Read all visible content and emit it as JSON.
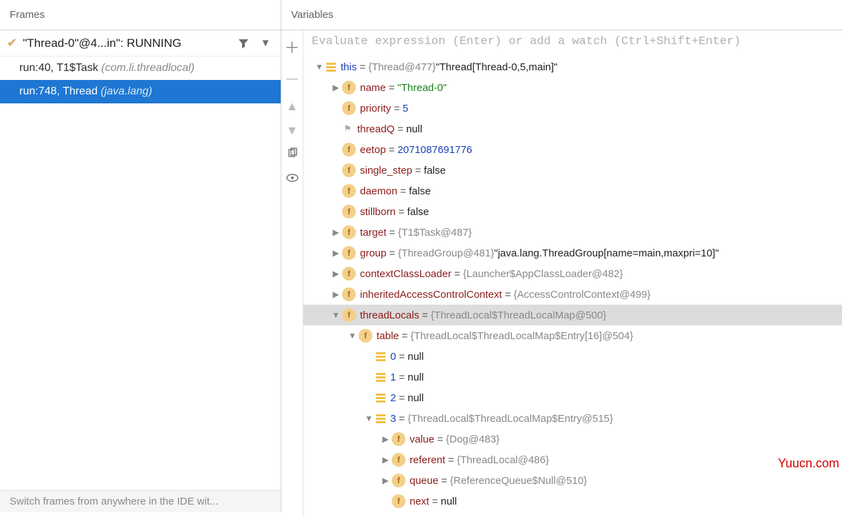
{
  "frames": {
    "header": "Frames",
    "thread": "\"Thread-0\"@4...in\": RUNNING",
    "rows": [
      {
        "loc": "run:40, T1$Task ",
        "pkg": "(com.li.threadlocal)"
      },
      {
        "loc": "run:748, Thread ",
        "pkg": "(java.lang)"
      }
    ],
    "tip": "Switch frames from anywhere in the IDE wit..."
  },
  "variables": {
    "header": "Variables",
    "eval_placeholder": "Evaluate expression (Enter) or add a watch (Ctrl+Shift+Enter)"
  },
  "tree": [
    {
      "d": 0,
      "ar": "down",
      "icon": "bars",
      "name": "this",
      "nclass": "blue",
      "val": "{Thread@477}",
      "vclass": "ref",
      "extra": " \"Thread[Thread-0,5,main]\""
    },
    {
      "d": 1,
      "ar": "right",
      "icon": "f",
      "name": "name",
      "nclass": "fname",
      "val": "\"Thread-0\"",
      "vclass": "strv"
    },
    {
      "d": 1,
      "ar": "none",
      "icon": "f",
      "name": "priority",
      "nclass": "fname",
      "val": "5",
      "vclass": "blue"
    },
    {
      "d": 1,
      "ar": "none",
      "icon": "flag",
      "name": "threadQ",
      "nclass": "fname",
      "val": "null",
      "vclass": "txtv"
    },
    {
      "d": 1,
      "ar": "none",
      "icon": "f",
      "name": "eetop",
      "nclass": "fname",
      "val": "2071087691776",
      "vclass": "blue"
    },
    {
      "d": 1,
      "ar": "none",
      "icon": "f",
      "name": "single_step",
      "nclass": "fname",
      "val": "false",
      "vclass": "txtv"
    },
    {
      "d": 1,
      "ar": "none",
      "icon": "f",
      "name": "daemon",
      "nclass": "fname",
      "val": "false",
      "vclass": "txtv"
    },
    {
      "d": 1,
      "ar": "none",
      "icon": "f",
      "name": "stillborn",
      "nclass": "fname",
      "val": "false",
      "vclass": "txtv"
    },
    {
      "d": 1,
      "ar": "right",
      "icon": "f",
      "name": "target",
      "nclass": "fname",
      "val": "{T1$Task@487}",
      "vclass": "ref"
    },
    {
      "d": 1,
      "ar": "right",
      "icon": "f",
      "name": "group",
      "nclass": "fname",
      "val": "{ThreadGroup@481}",
      "vclass": "ref",
      "extra": " \"java.lang.ThreadGroup[name=main,maxpri=10]\""
    },
    {
      "d": 1,
      "ar": "right",
      "icon": "f",
      "name": "contextClassLoader",
      "nclass": "fname",
      "val": "{Launcher$AppClassLoader@482}",
      "vclass": "ref"
    },
    {
      "d": 1,
      "ar": "right",
      "icon": "f",
      "name": "inheritedAccessControlContext",
      "nclass": "fname",
      "val": "{AccessControlContext@499}",
      "vclass": "ref"
    },
    {
      "d": 1,
      "ar": "down",
      "icon": "f",
      "name": "threadLocals",
      "nclass": "fname",
      "val": "{ThreadLocal$ThreadLocalMap@500}",
      "vclass": "ref",
      "sel": true
    },
    {
      "d": 2,
      "ar": "down",
      "icon": "f",
      "name": "table",
      "nclass": "fname",
      "val": "{ThreadLocal$ThreadLocalMap$Entry[16]@504}",
      "vclass": "ref"
    },
    {
      "d": 3,
      "ar": "none",
      "icon": "bars",
      "name": "0",
      "nclass": "blue",
      "val": "null",
      "vclass": "txtv"
    },
    {
      "d": 3,
      "ar": "none",
      "icon": "bars",
      "name": "1",
      "nclass": "blue",
      "val": "null",
      "vclass": "txtv"
    },
    {
      "d": 3,
      "ar": "none",
      "icon": "bars",
      "name": "2",
      "nclass": "blue",
      "val": "null",
      "vclass": "txtv"
    },
    {
      "d": 3,
      "ar": "down",
      "icon": "bars",
      "name": "3",
      "nclass": "blue",
      "val": "{ThreadLocal$ThreadLocalMap$Entry@515}",
      "vclass": "ref"
    },
    {
      "d": 4,
      "ar": "right",
      "icon": "f",
      "name": "value",
      "nclass": "fname",
      "val": "{Dog@483}",
      "vclass": "ref"
    },
    {
      "d": 4,
      "ar": "right",
      "icon": "f",
      "name": "referent",
      "nclass": "fname",
      "val": "{ThreadLocal@486}",
      "vclass": "ref"
    },
    {
      "d": 4,
      "ar": "right",
      "icon": "f",
      "name": "queue",
      "nclass": "fname",
      "val": "{ReferenceQueue$Null@510}",
      "vclass": "ref"
    },
    {
      "d": 4,
      "ar": "none",
      "icon": "f",
      "name": "next",
      "nclass": "fname",
      "val": "null",
      "vclass": "txtv"
    }
  ],
  "watermark": "Yuucn.com"
}
